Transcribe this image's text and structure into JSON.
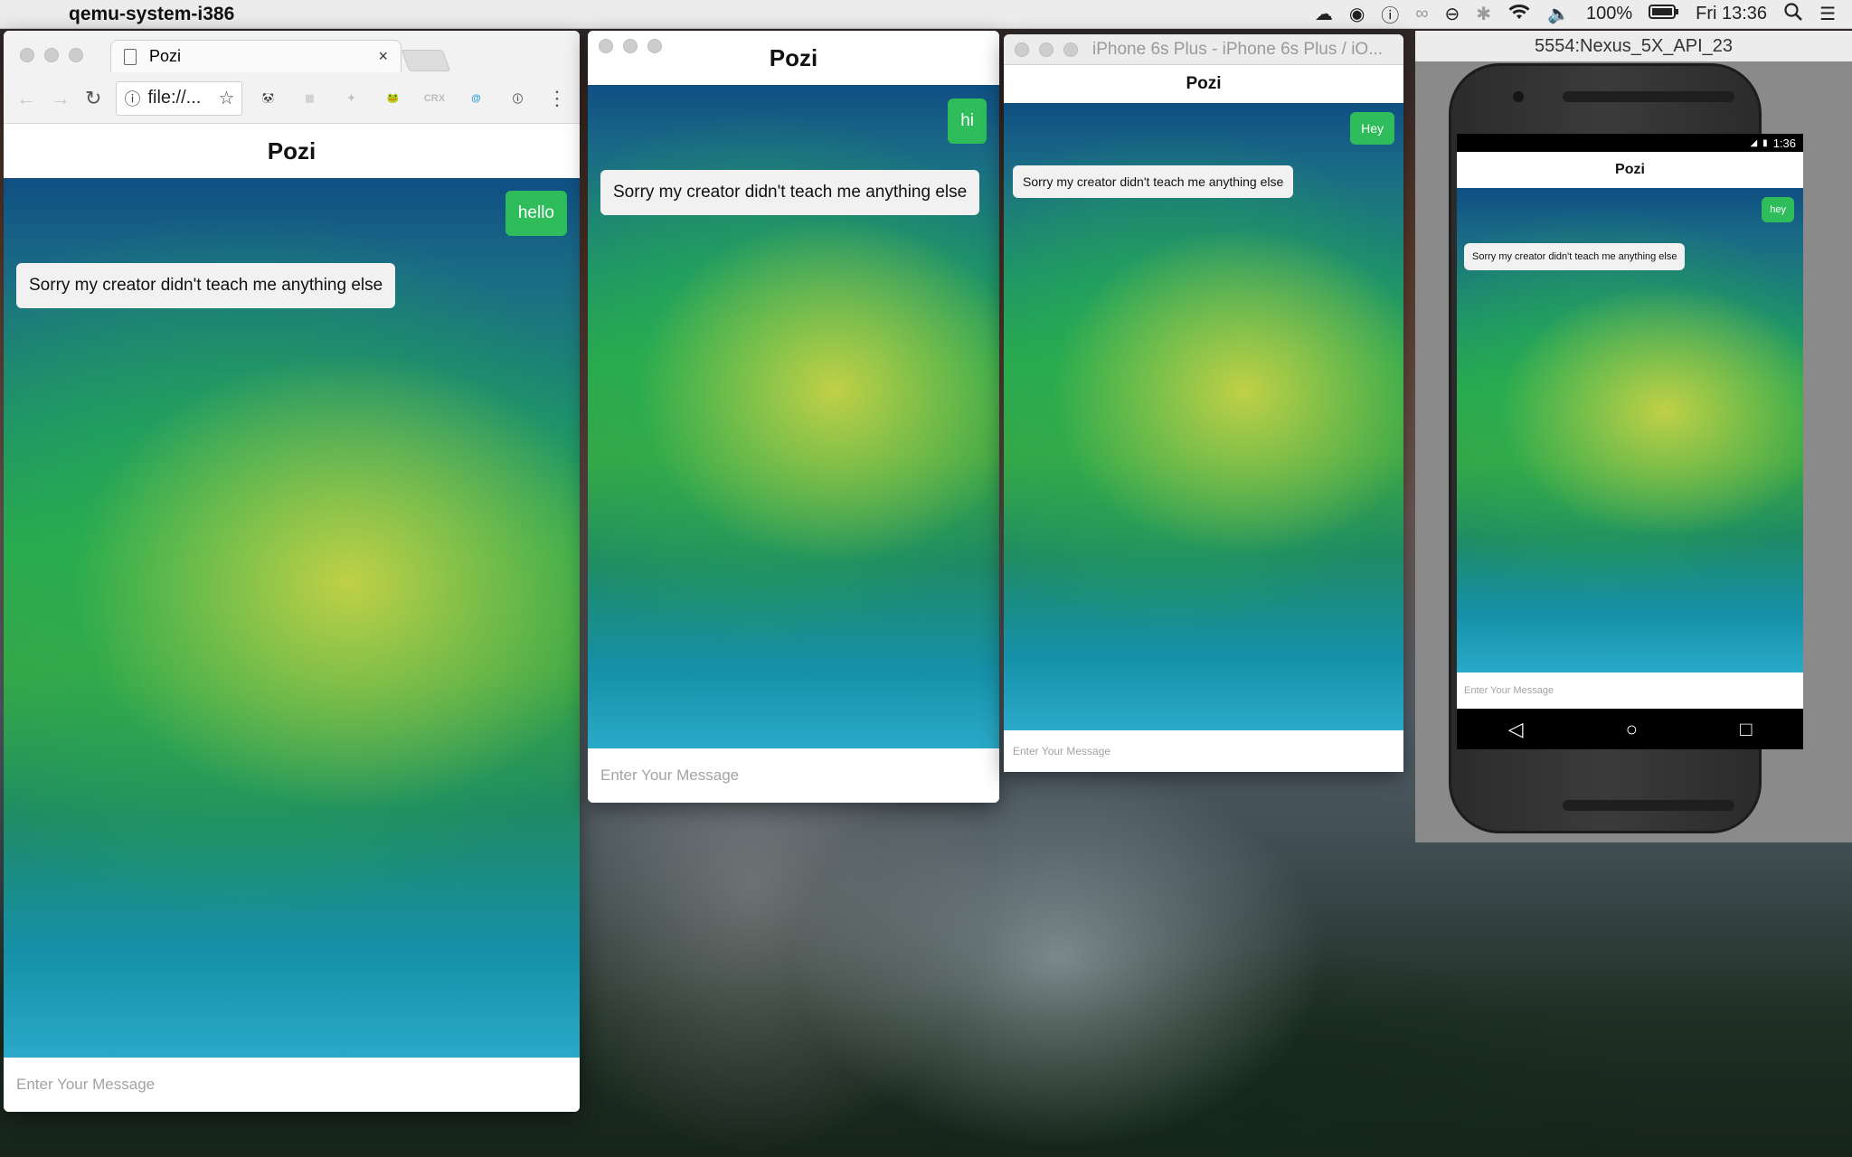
{
  "menubar": {
    "app_name": "qemu-system-i386",
    "battery": "100%",
    "clock": "Fri 13:36"
  },
  "chrome": {
    "tab_title": "Pozi",
    "tab_close": "×",
    "url": "file://...",
    "extensions": [
      {
        "name": "panda-extension-icon",
        "label": "🐼",
        "color": "#333333"
      },
      {
        "name": "grid-extension-icon",
        "label": "▦",
        "color": "#cfcfcf"
      },
      {
        "name": "puzzle-extension-icon",
        "label": "✦",
        "color": "#bdbdbd"
      },
      {
        "name": "frog-extension-icon",
        "label": "🐸",
        "color": "#5a9a3a"
      },
      {
        "name": "crx-extension-icon",
        "label": "CRX",
        "color": "#bdbdbd"
      },
      {
        "name": "at-extension-icon",
        "label": "@",
        "color": "#2a9fd8"
      },
      {
        "name": "info-extension-icon",
        "label": "ⓘ",
        "color": "#555555"
      }
    ]
  },
  "app": {
    "title": "Pozi",
    "input_placeholder": "Enter Your Message",
    "bot_reply": "Sorry my creator didn't teach me anything else"
  },
  "windows": {
    "chrome": {
      "user_message": "hello"
    },
    "mac_app": {
      "user_message": "hi"
    },
    "ios": {
      "window_title": "iPhone 6s Plus - iPhone 6s Plus / iO...",
      "user_message": "Hey"
    },
    "android": {
      "window_title": "5554:Nexus_5X_API_23",
      "user_message": "hey",
      "status_time": "1:36"
    }
  },
  "colors": {
    "user_bubble": "#2ebd5a",
    "bot_bubble": "#f1f1f1",
    "accent_background": "#1d8f6d"
  }
}
